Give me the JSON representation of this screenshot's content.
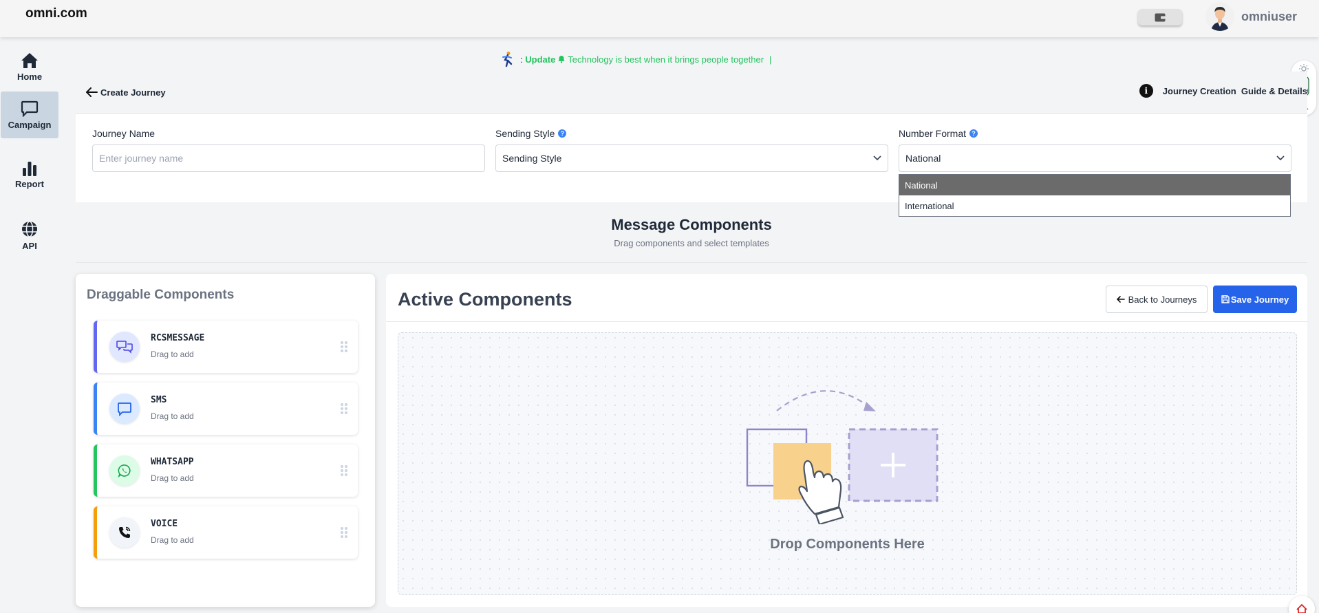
{
  "app": {
    "brand": "omni.com",
    "username": "omniuser"
  },
  "sidebar": {
    "items": [
      {
        "label": "Home",
        "icon": "home-icon"
      },
      {
        "label": "Campaign",
        "icon": "chat-icon",
        "active": true
      },
      {
        "label": "Report",
        "icon": "bar-chart-icon"
      },
      {
        "label": "API",
        "icon": "globe-icon"
      }
    ]
  },
  "ticker": {
    "prefix": ": ",
    "highlight": "Update",
    "message": "Technology is best when it brings people together",
    "cursor": "|"
  },
  "header": {
    "back_label": "Create Journey",
    "guide_label": "Journey Creation  Guide & Details"
  },
  "form": {
    "journey_name": {
      "label": "Journey Name",
      "placeholder": "Enter journey name",
      "value": ""
    },
    "sending_style": {
      "label": "Sending Style",
      "value": "Sending Style"
    },
    "number_format": {
      "label": "Number Format",
      "value": "National",
      "options": [
        "National",
        "International"
      ],
      "selected": "National"
    }
  },
  "message_components": {
    "title": "Message Components",
    "subtitle": "Drag components and select templates"
  },
  "draggable": {
    "title": "Draggable Components",
    "items": [
      {
        "name": "RCSMESSAGE",
        "hint": "Drag to add",
        "accent": "#6366f1",
        "icon": "chat-bubbles-icon"
      },
      {
        "name": "SMS",
        "hint": "Drag to add",
        "accent": "#3b82f6",
        "icon": "message-square-icon"
      },
      {
        "name": "WHATSAPP",
        "hint": "Drag to add",
        "accent": "#22c55e",
        "icon": "whatsapp-icon"
      },
      {
        "name": "VOICE",
        "hint": "Drag to add",
        "accent": "#f59e0b",
        "icon": "phone-icon"
      }
    ]
  },
  "active": {
    "title": "Active Components",
    "back_button": "Back to Journeys",
    "save_button": "Save Journey",
    "drop_text": "Drop Components Here"
  },
  "colors": {
    "primary": "#2563eb",
    "ticker_green": "#22c55e",
    "sidebar_active": "#c9d6e2"
  }
}
